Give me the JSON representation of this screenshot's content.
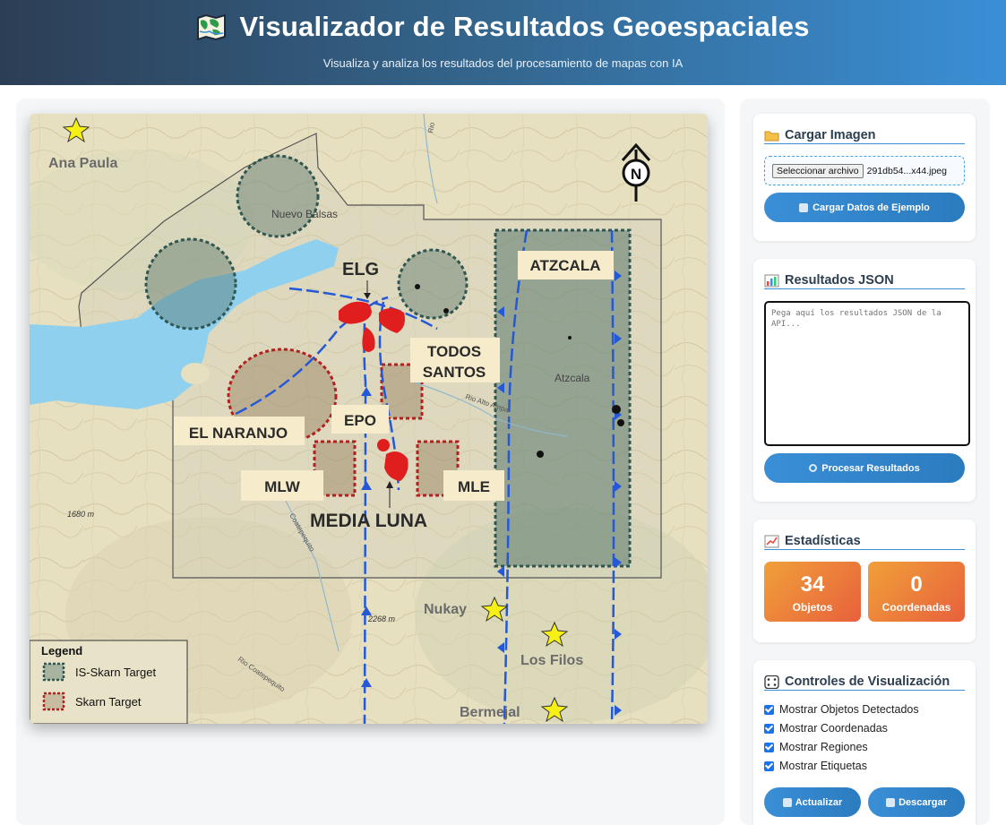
{
  "header": {
    "title": "Visualizador de Resultados Geoespaciales",
    "subtitle": "Visualiza y analiza los resultados del procesamiento de mapas con IA"
  },
  "map": {
    "labels": {
      "ana_paula": "Ana Paula",
      "nuevo_balsas": "Nuevo Balsas",
      "elg": "ELG",
      "atzcala_box": "ATZCALA",
      "todos_santos_1": "TODOS",
      "todos_santos_2": "SANTOS",
      "atzcala_town": "Atzcala",
      "el_naranjo": "EL NARANJO",
      "epo": "EPO",
      "mlw": "MLW",
      "mle": "MLE",
      "media_luna": "MEDIA LUNA",
      "elev_1680": "1680 m",
      "elev_2268": "2268 m",
      "nukay": "Nukay",
      "los_filos": "Los Filos",
      "bermejal": "Bermejal",
      "rio_left": "Rio Coatepequito",
      "rio_mid": "Coatepequito",
      "rio_top": "Rio",
      "rio_alto": "Rio Alto Ampa",
      "north": "N"
    },
    "legend": {
      "title": "Legend",
      "items": [
        "IS-Skarn Target",
        "Skarn Target"
      ]
    }
  },
  "upload_card": {
    "title": "Cargar Imagen",
    "icon": "folder-icon",
    "file_button": "Seleccionar archivo",
    "file_name": "291db54...x44.jpeg",
    "sample_button": "Cargar Datos de Ejemplo"
  },
  "json_card": {
    "title": "Resultados JSON",
    "icon": "bar-chart-icon",
    "placeholder": "Pega aquí los resultados JSON de la API...",
    "process_button": "Procesar Resultados"
  },
  "stats_card": {
    "title": "Estadísticas",
    "icon": "trend-chart-icon",
    "objects_value": "34",
    "objects_label": "Objetos",
    "coords_value": "0",
    "coords_label": "Coordenadas"
  },
  "controls_card": {
    "title": "Controles de Visualización",
    "icon": "dice-icon",
    "checkboxes": [
      {
        "label": "Mostrar Objetos Detectados",
        "checked": true
      },
      {
        "label": "Mostrar Coordenadas",
        "checked": true
      },
      {
        "label": "Mostrar Regiones",
        "checked": true
      },
      {
        "label": "Mostrar Etiquetas",
        "checked": true
      }
    ],
    "refresh_button": "Actualizar",
    "download_button": "Descargar"
  },
  "colors": {
    "accent": "#3a8fd6",
    "stat_gradient_start": "#f0a03a",
    "stat_gradient_end": "#e8603c",
    "header_start": "#2c3e55",
    "header_end": "#3a8fd6"
  }
}
